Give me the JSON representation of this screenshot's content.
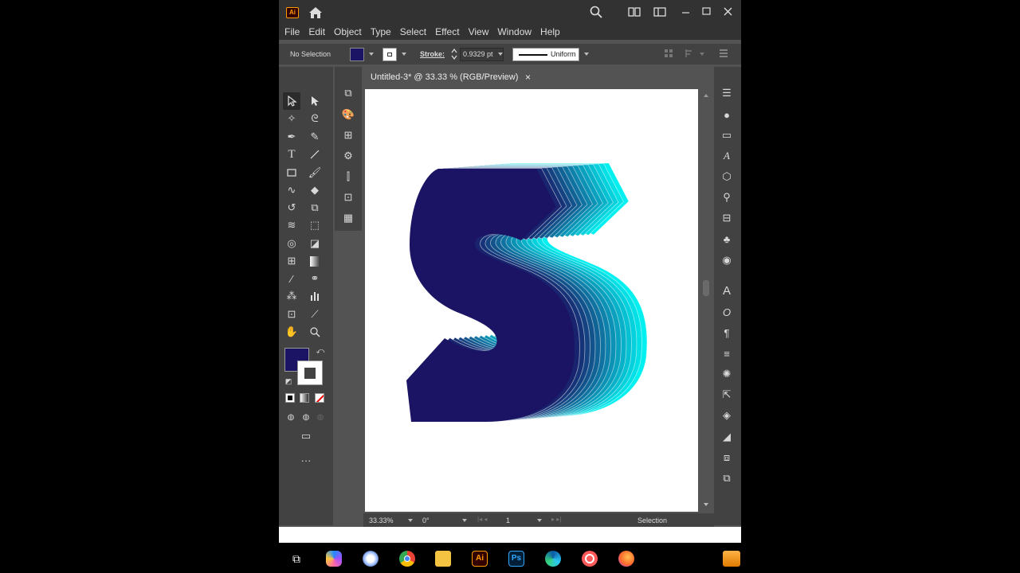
{
  "app": {
    "logo": "Ai",
    "menu": [
      "File",
      "Edit",
      "Object",
      "Type",
      "Select",
      "Effect",
      "View",
      "Window",
      "Help"
    ]
  },
  "control_bar": {
    "selection_label": "No Selection",
    "stroke_label": "Stroke:",
    "stroke_value": "0.9329 pt",
    "profile_label": "Uniform",
    "fill_color": "#1b1464",
    "stroke_color": "#ffffff"
  },
  "document": {
    "tab_title": "Untitled-3* @ 33.33 % (RGB/Preview)",
    "close_glyph": "×"
  },
  "status": {
    "zoom": "33.33%",
    "rotation": "0°",
    "artboard": "1",
    "tool": "Selection"
  },
  "tools": [
    "selection-tool",
    "direct-selection-tool",
    "magic-wand-tool",
    "lasso-tool",
    "pen-tool",
    "curvature-tool",
    "type-tool",
    "line-segment-tool",
    "rectangle-tool",
    "paintbrush-tool",
    "shaper-tool",
    "eraser-tool",
    "rotate-tool",
    "scale-tool",
    "warp-tool",
    "free-transform-tool",
    "shape-builder-tool",
    "perspective-grid-tool",
    "mesh-tool",
    "gradient-tool",
    "eyedropper-tool",
    "blend-tool",
    "symbol-sprayer-tool",
    "column-graph-tool",
    "artboard-tool",
    "slice-tool",
    "hand-tool",
    "zoom-tool"
  ],
  "colors": {
    "shape_dark": "#1b1464",
    "blend_light": "#00f0f0"
  }
}
